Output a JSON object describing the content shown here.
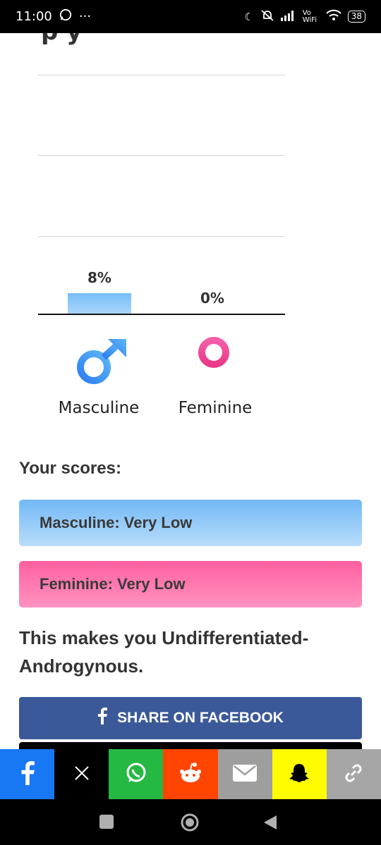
{
  "status": {
    "time": "11:00",
    "more": "···",
    "network": "Vo WiFi",
    "battery": "38"
  },
  "partial_heading": "p            y",
  "chart_data": {
    "type": "bar",
    "categories": [
      "Masculine",
      "Feminine"
    ],
    "values": [
      8,
      0
    ],
    "value_labels": [
      "8%",
      "0%"
    ],
    "colors": [
      "#90caf9",
      "#f06292"
    ]
  },
  "symbols": {
    "masculine": "male-symbol-icon",
    "feminine": "female-symbol-icon"
  },
  "scores": {
    "heading": "Your scores:",
    "masculine": "Masculine: Very Low",
    "feminine": "Feminine: Very Low",
    "result": "This makes you Undifferentiated-Androgynous."
  },
  "share": {
    "facebook_button": "SHARE ON FACEBOOK",
    "bar_colors": [
      "#1877f2",
      "#000000",
      "#25b843",
      "#ff4500",
      "#9e9e9e",
      "#fffc00",
      "#a6a6a6"
    ],
    "bar_icons": [
      "facebook-icon",
      "x-icon",
      "whatsapp-icon",
      "reddit-icon",
      "email-icon",
      "snapchat-icon",
      "link-icon"
    ]
  }
}
